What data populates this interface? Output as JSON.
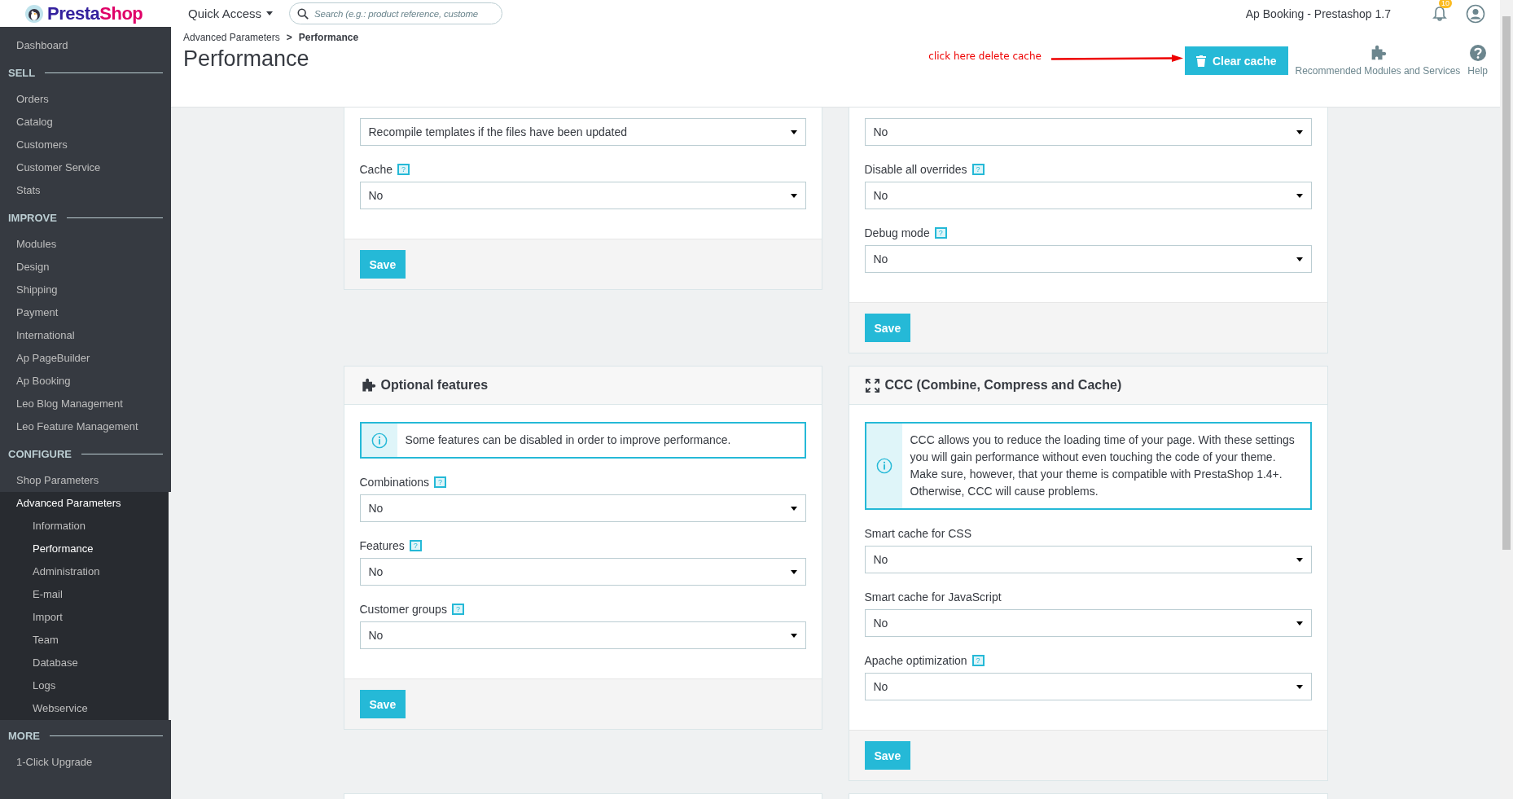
{
  "topbar": {
    "logo": {
      "part_1": "Presta",
      "part_2": "Shop"
    },
    "quick_access": "Quick Access",
    "search": {
      "placeholder": "Search (e.g.: product reference, custome"
    },
    "shop_name": "Ap Booking - Prestashop 1.7",
    "notifications": "10"
  },
  "sidebar": {
    "items": [
      {
        "kind": "item",
        "label": "Dashboard",
        "selected": false
      },
      {
        "kind": "section",
        "label": "SELL"
      },
      {
        "kind": "item",
        "label": "Orders",
        "selected": false
      },
      {
        "kind": "item",
        "label": "Catalog",
        "selected": false
      },
      {
        "kind": "item",
        "label": "Customers",
        "selected": false
      },
      {
        "kind": "item",
        "label": "Customer Service",
        "selected": false
      },
      {
        "kind": "item",
        "label": "Stats",
        "selected": false
      },
      {
        "kind": "section",
        "label": "IMPROVE"
      },
      {
        "kind": "item",
        "label": "Modules",
        "selected": false
      },
      {
        "kind": "item",
        "label": "Design",
        "selected": false
      },
      {
        "kind": "item",
        "label": "Shipping",
        "selected": false
      },
      {
        "kind": "item",
        "label": "Payment",
        "selected": false
      },
      {
        "kind": "item",
        "label": "International",
        "selected": false
      },
      {
        "kind": "item",
        "label": "Ap PageBuilder",
        "selected": false
      },
      {
        "kind": "item",
        "label": "Ap Booking",
        "selected": false
      },
      {
        "kind": "item",
        "label": "Leo Blog Management",
        "selected": false
      },
      {
        "kind": "item",
        "label": "Leo Feature Management",
        "selected": false
      },
      {
        "kind": "section",
        "label": "CONFIGURE"
      },
      {
        "kind": "item",
        "label": "Shop Parameters",
        "selected": false
      },
      {
        "kind": "item",
        "label": "Advanced Parameters",
        "selected": true,
        "expanded": true,
        "children": [
          {
            "label": "Information",
            "selected": false
          },
          {
            "label": "Performance",
            "selected": true
          },
          {
            "label": "Administration",
            "selected": false
          },
          {
            "label": "E-mail",
            "selected": false
          },
          {
            "label": "Import",
            "selected": false
          },
          {
            "label": "Team",
            "selected": false
          },
          {
            "label": "Database",
            "selected": false
          },
          {
            "label": "Logs",
            "selected": false
          },
          {
            "label": "Webservice",
            "selected": false
          }
        ]
      },
      {
        "kind": "section",
        "label": "MORE"
      },
      {
        "kind": "item",
        "label": "1-Click Upgrade",
        "selected": false
      }
    ]
  },
  "breadcrumb": {
    "parent": "Advanced Parameters",
    "separator": ">",
    "current": "Performance"
  },
  "title": "Performance",
  "annotation": "click here delete cache",
  "toolbar": [
    {
      "kind": "clear",
      "label": "Clear cache"
    },
    {
      "kind": "modules",
      "label": "Recommended Modules and Services"
    },
    {
      "kind": "help",
      "label": "Help"
    }
  ],
  "panels": [
    {
      "fields": [
        {
          "value": "Recompile templates if the files have been updated"
        },
        {
          "label": "Cache",
          "help": "?",
          "value": "No"
        }
      ],
      "button": "Save"
    },
    {
      "fields": [
        {
          "value": "No"
        },
        {
          "label": "Disable all overrides",
          "help": "?",
          "value": "No"
        },
        {
          "label": "Debug mode",
          "help": "?",
          "value": "No"
        }
      ],
      "button": "Save"
    },
    {
      "kind": "puzzle",
      "title": "Optional features",
      "alert": "Some features can be disabled in order to improve performance.",
      "fields": [
        {
          "label": "Combinations",
          "help": "?",
          "value": "No"
        },
        {
          "label": "Features",
          "help": "?",
          "value": "No"
        },
        {
          "label": "Customer groups",
          "help": "?",
          "value": "No"
        }
      ],
      "button": "Save"
    },
    {
      "kind": "expand",
      "title": "CCC (Combine, Compress and Cache)",
      "alert": "CCC allows you to reduce the loading time of your page. With these settings you will gain performance without even touching the code of your theme. Make sure, however, that your theme is compatible with PrestaShop 1.4+. Otherwise, CCC will cause problems.",
      "fields": [
        {
          "label": "Smart cache for CSS",
          "value": "No"
        },
        {
          "label": "Smart cache for JavaScript",
          "value": "No"
        },
        {
          "label": "Apache optimization",
          "help": "?",
          "value": "No"
        }
      ],
      "button": "Save"
    }
  ]
}
